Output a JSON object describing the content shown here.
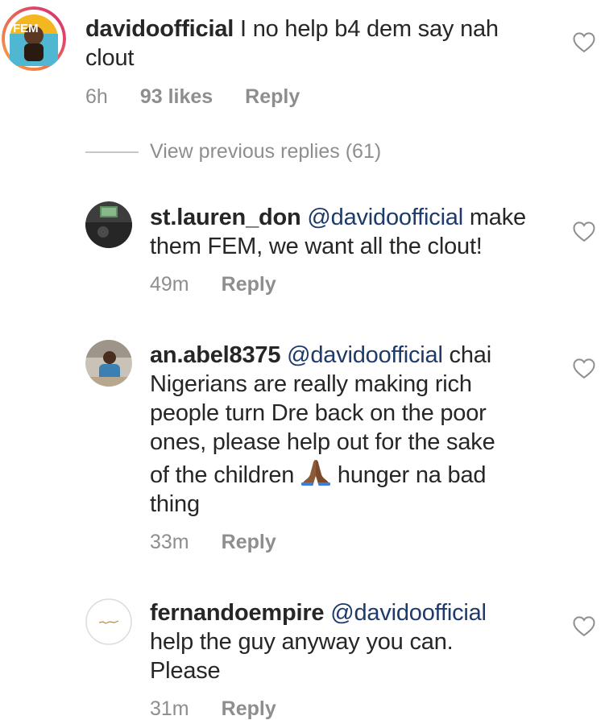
{
  "comments": [
    {
      "username": "davidoofficial",
      "body": "I no help b4 dem say nah",
      "body_line2": "clout",
      "time": "6h",
      "likes": "93 likes",
      "reply": "Reply",
      "avatar_text": "FEM"
    }
  ],
  "view_previous": "View previous replies (61)",
  "replies": [
    {
      "username": "st.lauren_don",
      "mention": "@davidoofficial",
      "line1_rest": "make",
      "line2": "them FEM, we want all the clout!",
      "time": "49m",
      "reply": "Reply"
    },
    {
      "username": "an.abel8375",
      "mention": "@davidoofficial",
      "line1_rest": "chai",
      "line2": "Nigerians are really making rich",
      "line3": "people turn Dre back on the poor",
      "line4": "ones, please help out for the sake",
      "line5_before": "of the children",
      "emoji": "folded-hands-emoji",
      "line5_after": "hunger na bad",
      "line6": "thing",
      "time": "33m",
      "reply": "Reply"
    },
    {
      "username": "fernandoempire",
      "mention": "@davidoofficial",
      "line2": "help the guy anyway you can.",
      "line3": "Please",
      "time": "31m",
      "reply": "Reply"
    }
  ],
  "colors": {
    "text": "#262626",
    "meta": "#8e8e8e",
    "mention": "#1e3a6b",
    "story_ring_start": "#f9a23a",
    "story_ring_end": "#d62976"
  },
  "icons": {
    "like": "heart-outline-icon"
  }
}
